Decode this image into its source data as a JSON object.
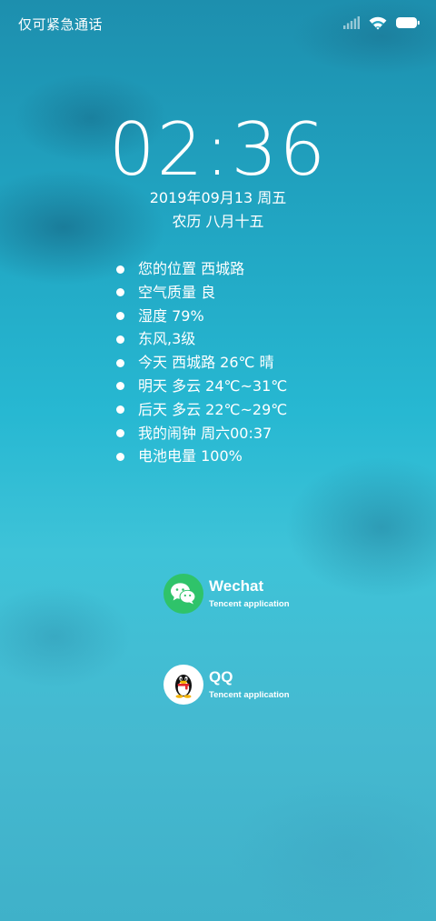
{
  "status_bar": {
    "carrier_text": "仅可紧急通话",
    "icons": [
      "signal-icon",
      "wifi-icon",
      "battery-icon"
    ]
  },
  "lockscreen": {
    "time": "02:36",
    "date": "2019年09月13 周五",
    "lunar_date": "农历 八月十五"
  },
  "info_items": [
    {
      "text": "您的位置 西城路"
    },
    {
      "text": "空气质量 良"
    },
    {
      "text": "湿度 79%"
    },
    {
      "text": "东风,3级"
    },
    {
      "text": "今天 西城路 26℃ 晴"
    },
    {
      "text": "明天 多云 24℃~31℃"
    },
    {
      "text": "后天 多云 22℃~29℃"
    },
    {
      "text": "我的闹钟 周六00:37"
    },
    {
      "text": "电池电量 100%"
    }
  ],
  "notifications": [
    {
      "app": "Wechat",
      "subtitle": "Tencent application",
      "icon": "wechat-icon",
      "color": "#2fc36a"
    },
    {
      "app": "QQ",
      "subtitle": "Tencent application",
      "icon": "qq-penguin-icon",
      "color": "#ffffff"
    }
  ]
}
